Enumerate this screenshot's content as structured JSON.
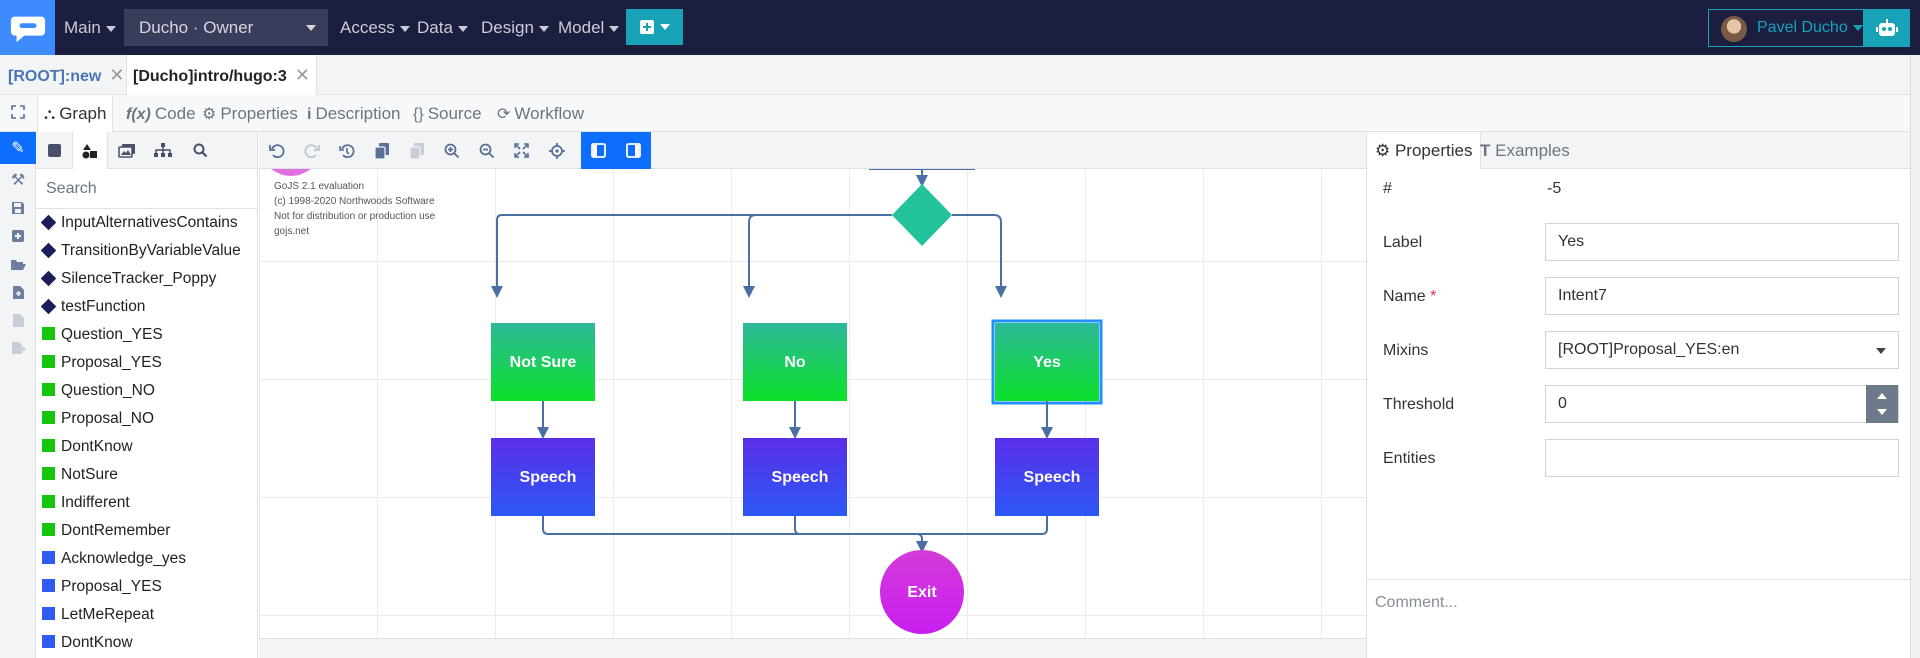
{
  "topbar": {
    "menus": [
      {
        "label": "Main"
      },
      {
        "label": "Access"
      },
      {
        "label": "Data"
      },
      {
        "label": "Design"
      },
      {
        "label": "Model"
      }
    ],
    "owner_select": "Ducho · Owner",
    "user_name": "Pavel Ducho"
  },
  "doc_tabs": [
    {
      "label": "[ROOT]:new",
      "active": false
    },
    {
      "label": "[Ducho]intro/hugo:3",
      "active": true
    }
  ],
  "editor_tabs": [
    {
      "label": "Graph",
      "icon": "sitemap-icon",
      "active": true
    },
    {
      "label": "Code",
      "icon": "function-icon"
    },
    {
      "label": "Properties",
      "icon": "gear-icon"
    },
    {
      "label": "Description",
      "icon": "info-icon"
    },
    {
      "label": "Source",
      "icon": "braces-icon"
    },
    {
      "label": "Workflow",
      "icon": "refresh-icon"
    }
  ],
  "palette": {
    "search_placeholder": "Search",
    "items": [
      {
        "label": "InputAlternativesContains",
        "kind": "function",
        "color": "#1c1e5c"
      },
      {
        "label": "TransitionByVariableValue",
        "kind": "function",
        "color": "#1c1e5c"
      },
      {
        "label": "SilenceTracker_Poppy",
        "kind": "function",
        "color": "#1c1e5c"
      },
      {
        "label": "testFunction",
        "kind": "function",
        "color": "#1c1e5c"
      },
      {
        "label": "Question_YES",
        "kind": "intent",
        "color": "#16c60c"
      },
      {
        "label": "Proposal_YES",
        "kind": "intent",
        "color": "#16c60c"
      },
      {
        "label": "Question_NO",
        "kind": "intent",
        "color": "#16c60c"
      },
      {
        "label": "Proposal_NO",
        "kind": "intent",
        "color": "#16c60c"
      },
      {
        "label": "DontKnow",
        "kind": "intent",
        "color": "#16c60c"
      },
      {
        "label": "NotSure",
        "kind": "intent",
        "color": "#16c60c"
      },
      {
        "label": "Indifferent",
        "kind": "intent",
        "color": "#16c60c"
      },
      {
        "label": "DontRemember",
        "kind": "intent",
        "color": "#16c60c"
      },
      {
        "label": "Acknowledge_yes",
        "kind": "speech",
        "color": "#2f5bf0"
      },
      {
        "label": "Proposal_YES",
        "kind": "speech",
        "color": "#2f5bf0"
      },
      {
        "label": "LetMeRepeat",
        "kind": "speech",
        "color": "#2f5bf0"
      },
      {
        "label": "DontKnow",
        "kind": "speech",
        "color": "#2f5bf0"
      }
    ]
  },
  "canvas": {
    "watermark": [
      "GoJS 2.1 evaluation",
      "(c) 1998-2020 Northwoods Software",
      "Not for distribution or production use",
      "gojs.net"
    ],
    "nodes": {
      "intent_left": "Not Sure",
      "intent_mid": "No",
      "intent_right": "Yes",
      "speech_left": "Speech",
      "speech_mid": "Speech",
      "speech_right": "Speech",
      "exit": "Exit"
    },
    "colors": {
      "intent_top": "#2db89a",
      "intent_bottom": "#0ce02a",
      "speech_top": "#5b2ee8",
      "speech_bottom": "#2b58f5",
      "exit_top": "#d43ad8",
      "exit_bottom": "#c81ef0",
      "decision": "#22c39a",
      "link": "#4a6fa5",
      "selection": "#1e90ff"
    }
  },
  "properties_panel": {
    "tabs": [
      {
        "label": "Properties",
        "icon": "gear-icon",
        "active": true
      },
      {
        "label": "Examples",
        "icon": "text-icon"
      }
    ],
    "fields": {
      "id_label": "#",
      "id_value": "-5",
      "label_label": "Label",
      "label_value": "Yes",
      "name_label": "Name",
      "name_value": "Intent7",
      "mixins_label": "Mixins",
      "mixins_value": "[ROOT]Proposal_YES:en",
      "threshold_label": "Threshold",
      "threshold_value": "0",
      "entities_label": "Entities",
      "entities_value": ""
    },
    "comment_placeholder": "Comment..."
  }
}
